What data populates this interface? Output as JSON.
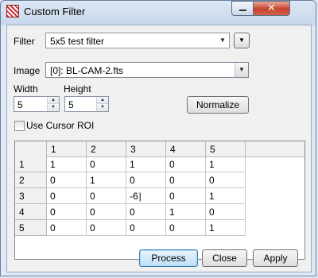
{
  "window": {
    "title": "Custom Filter",
    "close_glyph": "✕"
  },
  "filter": {
    "label": "Filter",
    "value": "5x5 test filter"
  },
  "image": {
    "label": "Image",
    "value": "[0]: BL-CAM-2.fts"
  },
  "width": {
    "label": "Width",
    "value": "5"
  },
  "height": {
    "label": "Height",
    "value": "5"
  },
  "normalize_label": "Normalize",
  "cursor_roi": {
    "label": "Use Cursor ROI",
    "checked": false
  },
  "grid": {
    "columns": [
      "1",
      "2",
      "3",
      "4",
      "5"
    ],
    "rows": [
      {
        "label": "1",
        "cells": [
          "1",
          "0",
          "1",
          "0",
          "1"
        ]
      },
      {
        "label": "2",
        "cells": [
          "0",
          "1",
          "0",
          "0",
          "0"
        ]
      },
      {
        "label": "3",
        "cells": [
          "0",
          "0",
          "-6",
          "0",
          "1"
        ]
      },
      {
        "label": "4",
        "cells": [
          "0",
          "0",
          "0",
          "1",
          "0"
        ]
      },
      {
        "label": "5",
        "cells": [
          "0",
          "0",
          "0",
          "0",
          "1"
        ]
      }
    ]
  },
  "buttons": {
    "process": "Process",
    "close": "Close",
    "apply": "Apply"
  },
  "icons": {
    "dropdown": "▼",
    "spin_up": "▲",
    "spin_down": "▼"
  }
}
